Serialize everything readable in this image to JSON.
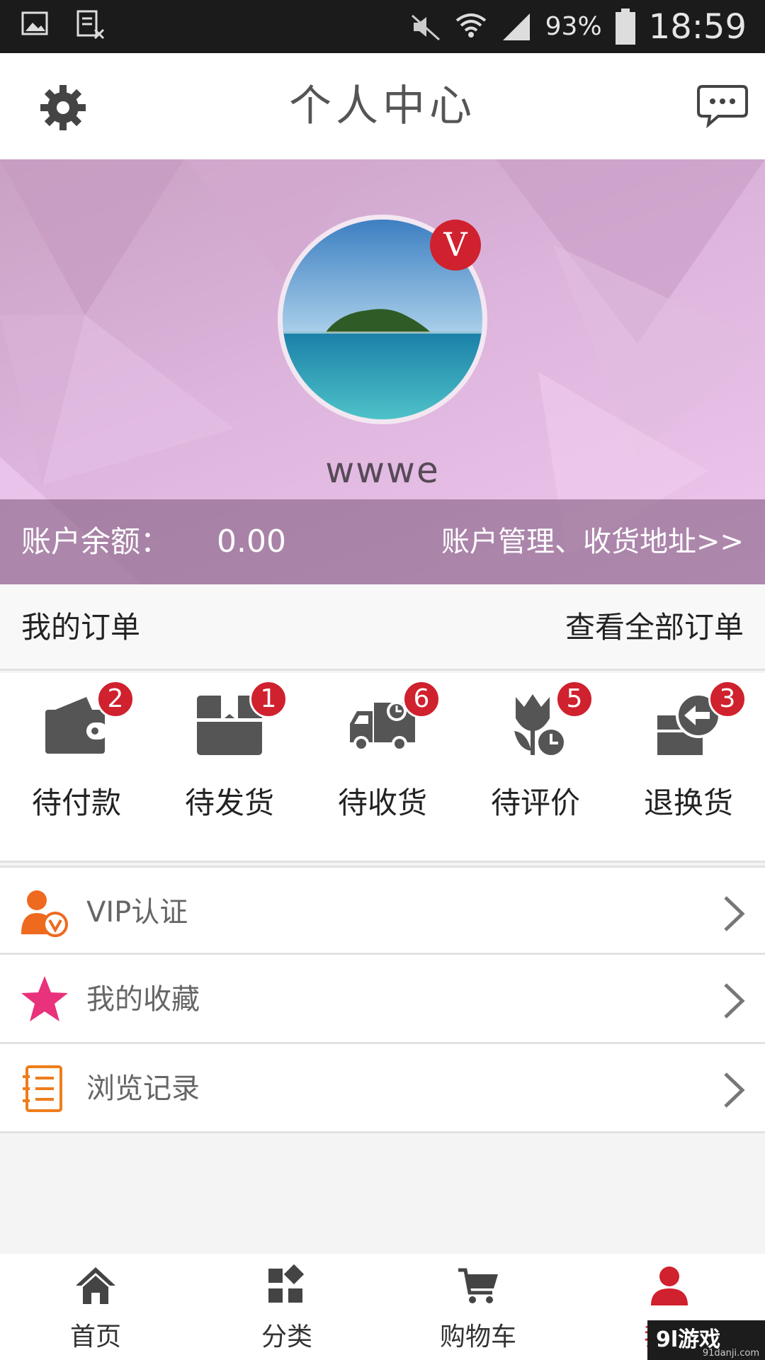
{
  "status_bar": {
    "battery_pct": "93%",
    "time": "18:59"
  },
  "header": {
    "title": "个人中心"
  },
  "profile": {
    "username": "wwwe",
    "vip_badge": "V",
    "balance_label": "账户余额：",
    "balance_value": "0.00",
    "account_link": "账户管理、收货地址>>"
  },
  "orders": {
    "title": "我的订单",
    "view_all": "查看全部订单",
    "statuses": [
      {
        "label": "待付款",
        "count": "2",
        "icon": "wallet-icon"
      },
      {
        "label": "待发货",
        "count": "1",
        "icon": "package-box-icon"
      },
      {
        "label": "待收货",
        "count": "6",
        "icon": "delivery-truck-icon"
      },
      {
        "label": "待评价",
        "count": "5",
        "icon": "flower-clock-icon"
      },
      {
        "label": "退换货",
        "count": "3",
        "icon": "return-box-icon"
      }
    ]
  },
  "menu": [
    {
      "label": "VIP认证",
      "icon": "vip-user-icon"
    },
    {
      "label": "我的收藏",
      "icon": "star-icon"
    },
    {
      "label": "浏览记录",
      "icon": "history-list-icon"
    }
  ],
  "tabbar": [
    {
      "label": "首页",
      "icon": "home-icon"
    },
    {
      "label": "分类",
      "icon": "category-grid-icon"
    },
    {
      "label": "购物车",
      "icon": "cart-icon"
    },
    {
      "label": "我的",
      "icon": "user-icon",
      "active": true
    }
  ],
  "watermark": {
    "brand": "9l游戏",
    "site": "91danji.com"
  },
  "colors": {
    "accent": "#d0212e",
    "banner": "#dcb4dc",
    "dark_icon": "#555555"
  }
}
